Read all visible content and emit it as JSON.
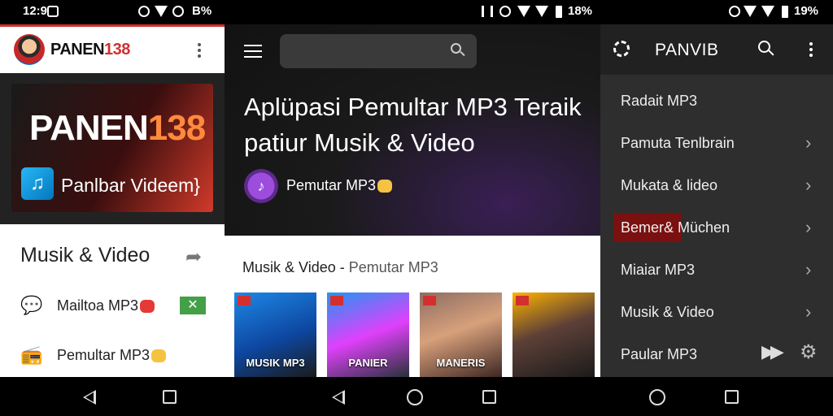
{
  "status_bar": {
    "left_time": "12:9",
    "left_battery": "B%",
    "middle_battery": "18%",
    "right_battery": "19%"
  },
  "panel1": {
    "brand_name_a": "PANEN",
    "brand_name_b": "138",
    "hero_logo_a": "PANEN",
    "hero_logo_b": "138",
    "hero_subtitle": "Panlbar Videem}",
    "section_title": "Musik & Video",
    "rows": [
      {
        "label": "Mailtoa MP3",
        "icon": "chat-bubble-icon"
      },
      {
        "label": "Pemultar MP3",
        "icon": "radio-icon"
      }
    ]
  },
  "panel2": {
    "headline": "Aplüpasi Pemultar MP3 Teraik patiur Musik & Video",
    "app_name": "Pemutar MP3",
    "section_title": "Musik & Video",
    "section_subtitle": "Pemutar MP3",
    "albums": [
      {
        "title": "MUSIK MP3",
        "bg": "linear-gradient(160deg,#1e88e5,#0d47a1 55%,#1b1b1b)"
      },
      {
        "title": "PANIER",
        "bg": "linear-gradient(160deg,#2196f3,#e040fb 50%,#263238)"
      },
      {
        "title": "MANERIS",
        "bg": "linear-gradient(160deg,#8d6e63,#d7a07b 45%,#3e2723)"
      },
      {
        "title": "",
        "bg": "linear-gradient(160deg,#ffb300,#5d4037 45%,#1b1b1b)"
      }
    ]
  },
  "panel3": {
    "title": "PANVIB",
    "items": [
      {
        "label": "Radait MP3",
        "chevron": ""
      },
      {
        "label": "Pamuta Tenlbrain",
        "chevron": "›"
      },
      {
        "label": "Mukata & lideo",
        "chevron": "›"
      },
      {
        "label": "Bemer& Müchen",
        "chevron": "›"
      },
      {
        "label": "Miaiar MP3",
        "chevron": "›"
      },
      {
        "label": "Musik & Video",
        "chevron": "›"
      },
      {
        "label": "Paular MP3",
        "chevron": ""
      }
    ]
  }
}
